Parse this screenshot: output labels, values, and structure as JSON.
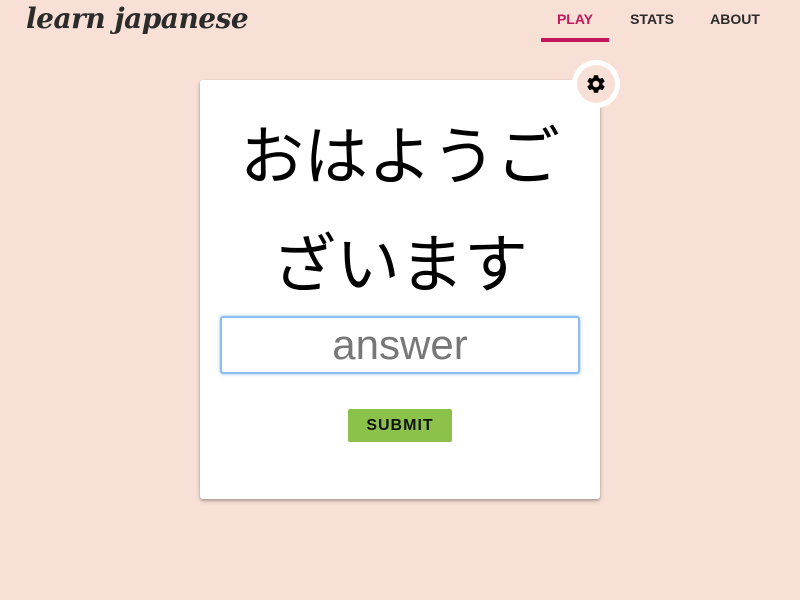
{
  "app": {
    "logo": "learn japanese"
  },
  "nav": {
    "items": [
      {
        "label": "PLAY",
        "active": true
      },
      {
        "label": "STATS",
        "active": false
      },
      {
        "label": "ABOUT",
        "active": false
      }
    ]
  },
  "card": {
    "prompt": "おはようございます",
    "answer": {
      "value": "",
      "placeholder": "answer"
    },
    "submit_label": "SUBMIT",
    "settings_icon": "gear-icon"
  },
  "colors": {
    "background": "#f9e0d7",
    "accent": "#c2185b",
    "submit": "#8bc34a",
    "input_focus": "#8cbdf2"
  }
}
